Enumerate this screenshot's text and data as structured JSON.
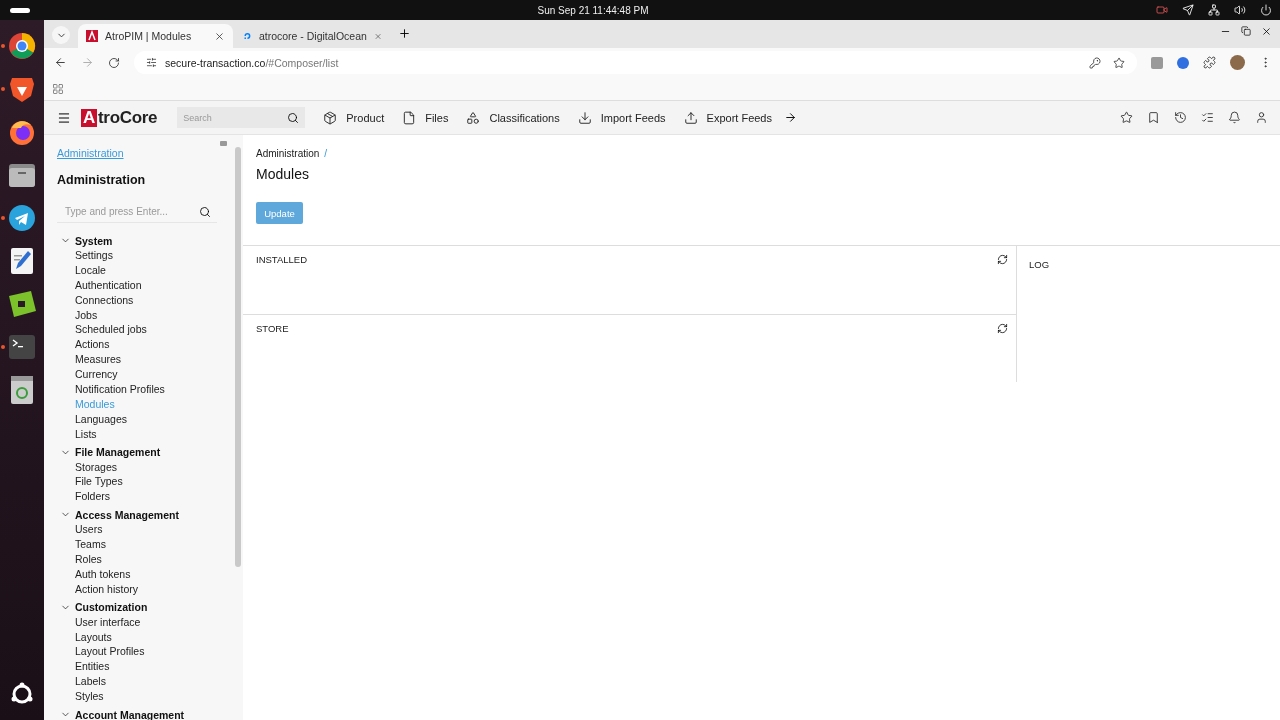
{
  "system_bar": {
    "clock": "Sun Sep 21  11:44:48 PM"
  },
  "dock": [
    {
      "kind": "chrome",
      "running": true
    },
    {
      "kind": "brave",
      "running": true
    },
    {
      "kind": "firefox",
      "running": false
    },
    {
      "kind": "files",
      "running": false
    },
    {
      "kind": "telegram",
      "running": true
    },
    {
      "kind": "editor",
      "running": false
    },
    {
      "kind": "green",
      "running": false
    },
    {
      "kind": "terminal",
      "running": true
    },
    {
      "kind": "trash",
      "running": false
    }
  ],
  "browser": {
    "tabs": [
      {
        "title": "AtroPIM | Modules",
        "kind": "atro",
        "selected": true
      },
      {
        "title": "atrocore - DigitalOcean",
        "kind": "ocean",
        "selected": false
      }
    ],
    "url": {
      "host": "secure-transaction.co",
      "path": "/#Composer/list"
    }
  },
  "app": {
    "logo": {
      "mark": "A",
      "rest": "troCore"
    },
    "search": {
      "placeholder": "Search"
    },
    "nav": [
      {
        "label": "Product",
        "kind": "product"
      },
      {
        "label": "Files",
        "kind": "files"
      },
      {
        "label": "Classifications",
        "kind": "classifications"
      },
      {
        "label": "Import Feeds",
        "kind": "import"
      },
      {
        "label": "Export Feeds",
        "kind": "export"
      }
    ]
  },
  "sidebar": {
    "link": "Administration",
    "title": "Administration",
    "search": {
      "placeholder": "Type and press Enter..."
    },
    "groups": [
      {
        "label": "System",
        "expanded": true,
        "children": [
          {
            "label": "Settings",
            "selected": false
          },
          {
            "label": "Locale",
            "selected": false
          },
          {
            "label": "Authentication",
            "selected": false
          },
          {
            "label": "Connections",
            "selected": false
          },
          {
            "label": "Jobs",
            "selected": false
          },
          {
            "label": "Scheduled jobs",
            "selected": false
          },
          {
            "label": "Actions",
            "selected": false
          },
          {
            "label": "Measures",
            "selected": false
          },
          {
            "label": "Currency",
            "selected": false
          },
          {
            "label": "Notification Profiles",
            "selected": false
          },
          {
            "label": "Modules",
            "selected": true
          },
          {
            "label": "Languages",
            "selected": false
          },
          {
            "label": "Lists",
            "selected": false
          }
        ]
      },
      {
        "label": "File Management",
        "expanded": true,
        "children": [
          {
            "label": "Storages",
            "selected": false
          },
          {
            "label": "File Types",
            "selected": false
          },
          {
            "label": "Folders",
            "selected": false
          }
        ]
      },
      {
        "label": "Access Management",
        "expanded": true,
        "children": [
          {
            "label": "Users",
            "selected": false
          },
          {
            "label": "Teams",
            "selected": false
          },
          {
            "label": "Roles",
            "selected": false
          },
          {
            "label": "Auth tokens",
            "selected": false
          },
          {
            "label": "Action history",
            "selected": false
          }
        ]
      },
      {
        "label": "Customization",
        "expanded": true,
        "children": [
          {
            "label": "User interface",
            "selected": false
          },
          {
            "label": "Layouts",
            "selected": false
          },
          {
            "label": "Layout Profiles",
            "selected": false
          },
          {
            "label": "Entities",
            "selected": false
          },
          {
            "label": "Labels",
            "selected": false
          },
          {
            "label": "Styles",
            "selected": false
          }
        ]
      },
      {
        "label": "Account Management",
        "expanded": true
      }
    ]
  },
  "main": {
    "breadcrumb": "Administration",
    "separator": "/",
    "title": "Modules",
    "update_button": "Update",
    "panels": {
      "installed": "INSTALLED",
      "store": "STORE",
      "log": "LOG"
    }
  }
}
